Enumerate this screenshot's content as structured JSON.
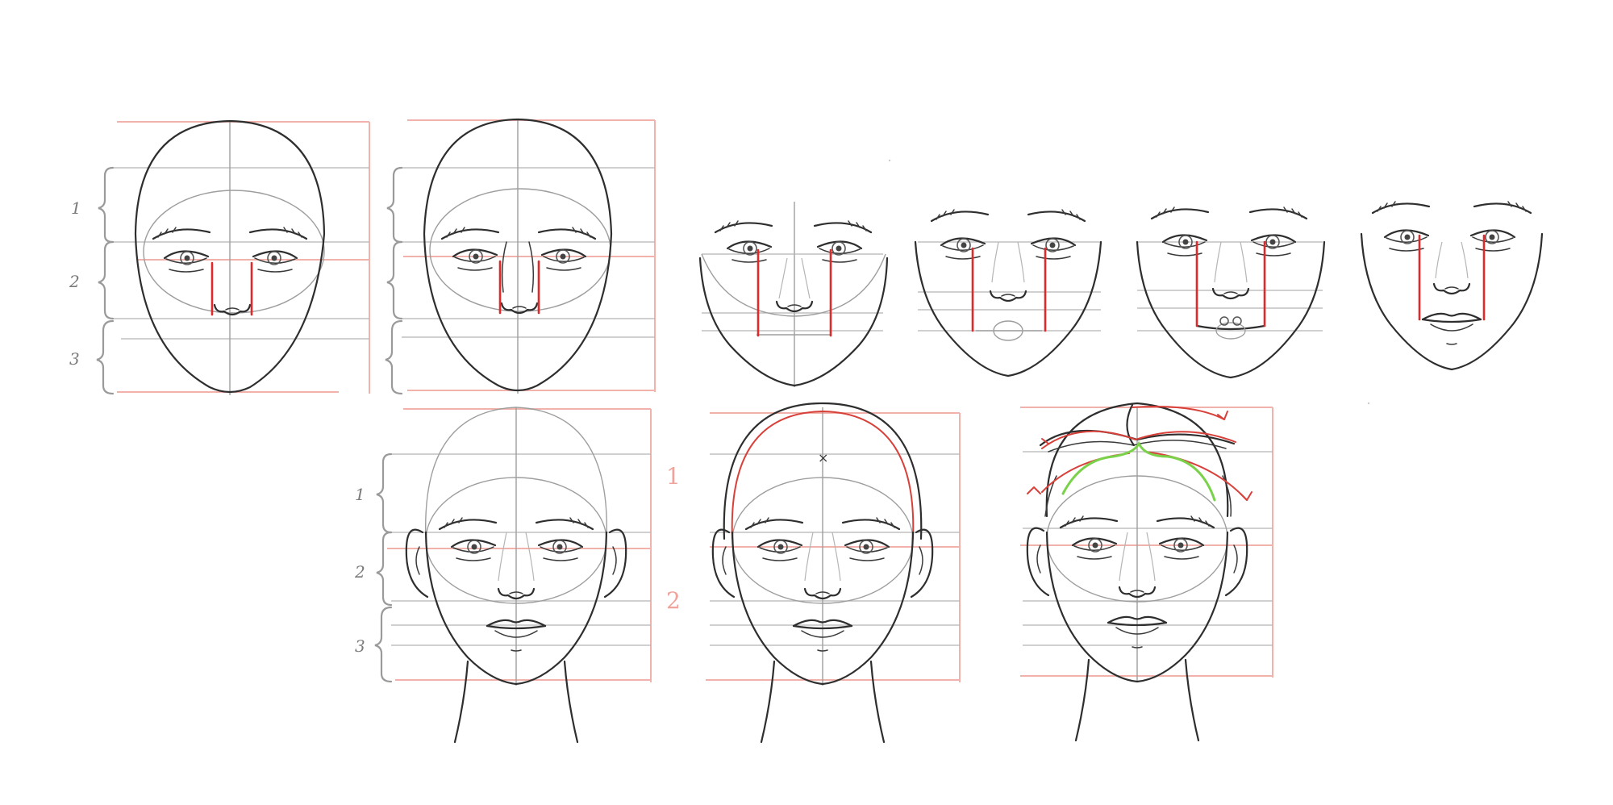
{
  "sheet": {
    "grid_color": "#f0b2ab",
    "accent_red": "#e02a2a",
    "accent_green": "#7ad24a",
    "ink_color": "#2e2e2e",
    "guide_color": "#9e9e9e"
  },
  "section_numbers": [
    "1",
    "2",
    "3"
  ],
  "head_halves": [
    "1",
    "2"
  ],
  "mark": "×"
}
